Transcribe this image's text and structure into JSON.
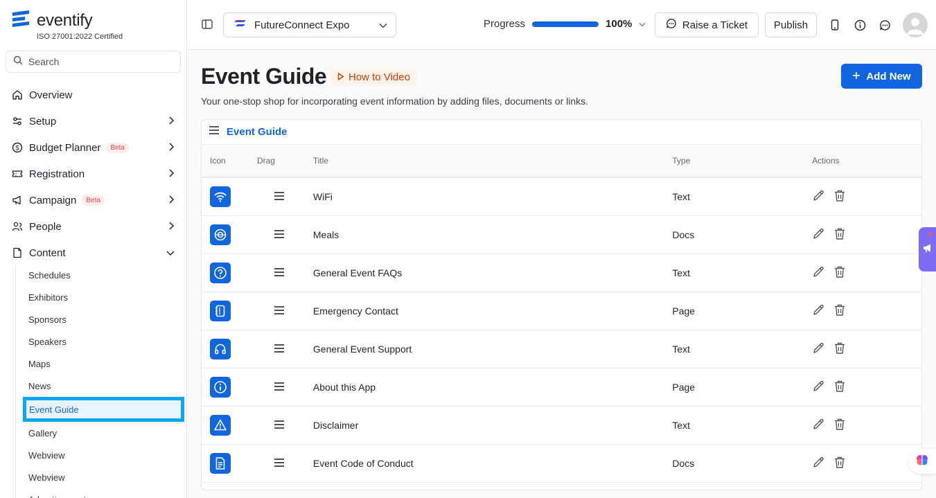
{
  "brand": {
    "name": "eventify",
    "certification": "ISO 27001:2022 Certified"
  },
  "search": {
    "placeholder": "Search"
  },
  "sidebar": {
    "items": [
      {
        "label": "Overview",
        "icon": "home-icon"
      },
      {
        "label": "Setup",
        "icon": "sliders-icon"
      },
      {
        "label": "Budget Planner",
        "badge": "Beta",
        "icon": "dollar-icon"
      },
      {
        "label": "Registration",
        "icon": "ticket-icon"
      },
      {
        "label": "Campaign",
        "badge": "Beta",
        "icon": "megaphone-icon"
      },
      {
        "label": "People",
        "icon": "users-icon"
      },
      {
        "label": "Content",
        "icon": "document-icon"
      }
    ],
    "content_sub": [
      "Schedules",
      "Exhibitors",
      "Sponsors",
      "Speakers",
      "Maps",
      "News",
      "Event Guide",
      "Gallery",
      "Webview",
      "Webview",
      "Advertisements"
    ],
    "active_sub": "Event Guide"
  },
  "topbar": {
    "event_name": "FutureConnect Expo",
    "progress_label": "Progress",
    "progress_value": "100%",
    "progress_fraction": 1.0,
    "ticket_label": "Raise a Ticket",
    "publish_label": "Publish"
  },
  "page": {
    "title": "Event Guide",
    "video_label": "How to Video",
    "subtitle": "Your one-stop shop for incorporating event information by adding files, documents or links.",
    "add_label": "Add New"
  },
  "table": {
    "card_title": "Event Guide",
    "headers": {
      "icon": "Icon",
      "drag": "Drag",
      "title": "Title",
      "type": "Type",
      "actions": "Actions"
    },
    "rows": [
      {
        "icon": "wifi-icon",
        "title": "WiFi",
        "type": "Text"
      },
      {
        "icon": "meal-icon",
        "title": "Meals",
        "type": "Docs"
      },
      {
        "icon": "question-icon",
        "title": "General Event FAQs",
        "type": "Text"
      },
      {
        "icon": "contact-book-icon",
        "title": "Emergency Contact",
        "type": "Page"
      },
      {
        "icon": "headphones-icon",
        "title": "General Event Support",
        "type": "Text"
      },
      {
        "icon": "info-icon",
        "title": "About this App",
        "type": "Page"
      },
      {
        "icon": "warning-icon",
        "title": "Disclaimer",
        "type": "Text"
      },
      {
        "icon": "file-text-icon",
        "title": "Event Code of Conduct",
        "type": "Docs"
      }
    ]
  },
  "colors": {
    "primary": "#1166e0",
    "accent_video": "#c2410c",
    "beta": "#e5484d",
    "active_outline": "#0aa5f5",
    "float_tab": "#7c6cf0"
  }
}
